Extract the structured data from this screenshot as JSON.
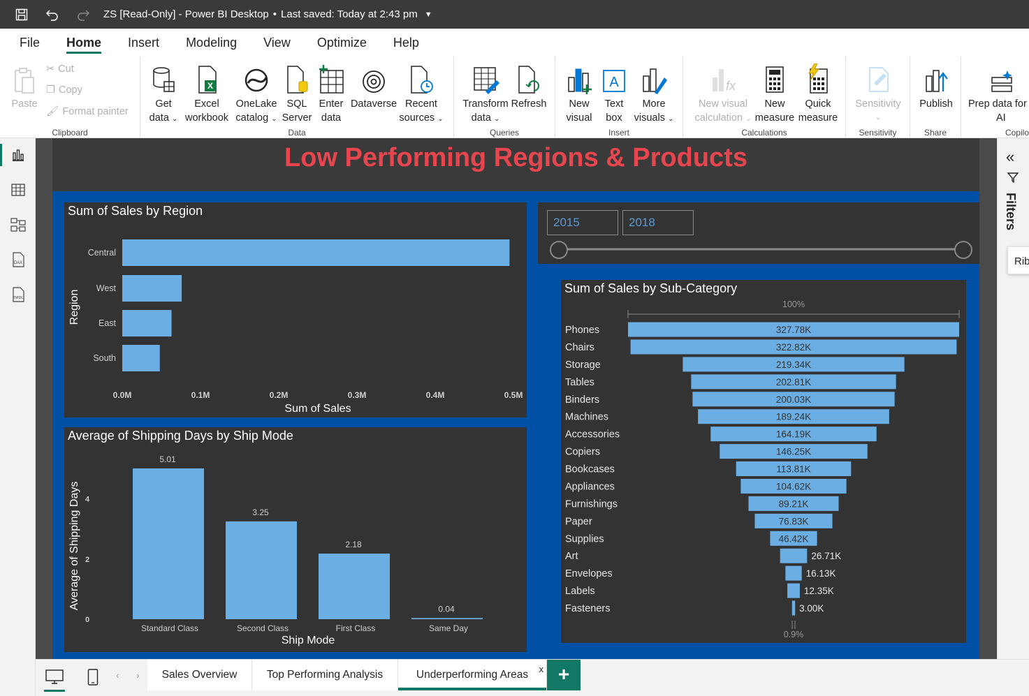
{
  "titlebar": {
    "title": "ZS [Read-Only] - Power BI Desktop",
    "saved": "Last saved: Today at 2:43 pm"
  },
  "menu": {
    "tabs": [
      "File",
      "Home",
      "Insert",
      "Modeling",
      "View",
      "Optimize",
      "Help"
    ],
    "active": "Home"
  },
  "ribbon": {
    "clipboard": {
      "paste": "Paste",
      "cut": "Cut",
      "copy": "Copy",
      "format_painter": "Format painter",
      "label": "Clipboard"
    },
    "data": {
      "label": "Data",
      "get_data": [
        "Get",
        "data"
      ],
      "excel": [
        "Excel",
        "workbook"
      ],
      "onelake": [
        "OneLake",
        "catalog"
      ],
      "sql": [
        "SQL",
        "Server"
      ],
      "enter": [
        "Enter",
        "data"
      ],
      "dataverse": "Dataverse",
      "recent": [
        "Recent",
        "sources"
      ]
    },
    "queries": {
      "label": "Queries",
      "transform": [
        "Transform",
        "data"
      ],
      "refresh": "Refresh"
    },
    "insert": {
      "label": "Insert",
      "new_visual": [
        "New",
        "visual"
      ],
      "text_box": [
        "Text",
        "box"
      ],
      "more_visuals": [
        "More",
        "visuals"
      ]
    },
    "calculations": {
      "label": "Calculations",
      "new_visual_calc": [
        "New visual",
        "calculation"
      ],
      "new_measure": [
        "New",
        "measure"
      ],
      "quick_measure": [
        "Quick",
        "measure"
      ]
    },
    "sensitivity": {
      "label": "Sensitivity",
      "btn": "Sensitivity"
    },
    "share": {
      "label": "Share",
      "publish": "Publish"
    },
    "prep": {
      "label": "Copilo",
      "btn": [
        "Prep data for",
        "AI"
      ]
    }
  },
  "report": {
    "title": "Low Performing Regions & Products",
    "slicer": {
      "start": "2015",
      "end": "2018"
    }
  },
  "chart_data": [
    {
      "type": "bar",
      "orientation": "horizontal",
      "title": "Sum of Sales by Region",
      "xlabel": "Sum of Sales",
      "ylabel": "Region",
      "categories": [
        "Central",
        "West",
        "East",
        "South"
      ],
      "values": [
        0.495,
        0.076,
        0.063,
        0.048
      ],
      "xticks": [
        "0.0M",
        "0.1M",
        "0.2M",
        "0.3M",
        "0.4M",
        "0.5M"
      ],
      "xlim": [
        0,
        0.5
      ]
    },
    {
      "type": "bar",
      "title": "Average of Shipping Days by Ship Mode",
      "xlabel": "Ship Mode",
      "ylabel": "Average of Shipping Days",
      "categories": [
        "Standard Class",
        "Second Class",
        "First Class",
        "Same Day"
      ],
      "values": [
        5.01,
        3.25,
        2.18,
        0.04
      ],
      "labels": [
        "5.01",
        "3.25",
        "2.18",
        "0.04"
      ],
      "yticks": [
        "0",
        "2",
        "4"
      ],
      "ylim": [
        0,
        5.01
      ]
    },
    {
      "type": "funnel",
      "title": "Sum of Sales by Sub-Category",
      "top_label": "100%",
      "bottom_label": "0.9%",
      "categories": [
        "Phones",
        "Chairs",
        "Storage",
        "Tables",
        "Binders",
        "Machines",
        "Accessories",
        "Copiers",
        "Bookcases",
        "Appliances",
        "Furnishings",
        "Paper",
        "Supplies",
        "Art",
        "Envelopes",
        "Labels",
        "Fasteners"
      ],
      "values": [
        327.78,
        322.82,
        219.34,
        202.81,
        200.03,
        189.24,
        164.19,
        146.25,
        113.81,
        104.62,
        89.21,
        76.83,
        46.42,
        26.71,
        16.13,
        12.35,
        3.0
      ],
      "labels": [
        "327.78K",
        "322.82K",
        "219.34K",
        "202.81K",
        "200.03K",
        "189.24K",
        "164.19K",
        "146.25K",
        "113.81K",
        "104.62K",
        "89.21K",
        "76.83K",
        "46.42K",
        "26.71K",
        "16.13K",
        "12.35K",
        "3.00K"
      ]
    }
  ],
  "filters": {
    "label": "Filters",
    "tooltip": "Rib"
  },
  "pages": {
    "tabs": [
      "Sales Overview",
      "Top Performing Analysis",
      "Underperforming Areas"
    ],
    "active": "Underperforming Areas",
    "close": "x",
    "add": "+"
  },
  "colors": {
    "bar": "#6aaee3",
    "title": "#e8464e",
    "accent": "#117865",
    "panel_bg": "#333333",
    "blue_bg": "#0050a5"
  }
}
